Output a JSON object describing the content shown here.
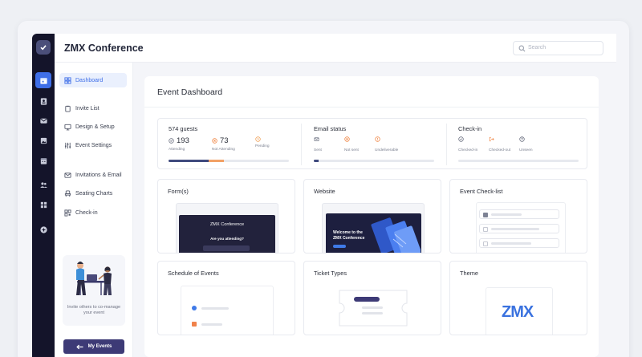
{
  "app": {
    "title": "ZMX Conference",
    "search_placeholder": "Search",
    "accent_color": "#3f6fe8",
    "rail_color": "#14142a"
  },
  "rail": {
    "icons": [
      "check-logo-icon",
      "calendar-icon",
      "contacts-icon",
      "mail-icon",
      "image-icon",
      "calendar-grid-icon",
      "users-icon",
      "apps-icon",
      "plus-circle-icon"
    ]
  },
  "sidebar": {
    "items": [
      {
        "label": "Dashboard",
        "icon": "dashboard-icon",
        "active": true
      },
      {
        "label": "Invite List",
        "icon": "clipboard-icon"
      },
      {
        "label": "Design & Setup",
        "icon": "monitor-icon"
      },
      {
        "label": "Event Settings",
        "icon": "sliders-icon"
      },
      {
        "label": "Invitations & Email",
        "icon": "mail-icon"
      },
      {
        "label": "Seating Charts",
        "icon": "seat-icon"
      },
      {
        "label": "Check-in",
        "icon": "qr-icon"
      }
    ],
    "promo_text": "Invite others to co-manage your event",
    "my_events_label": "My Events"
  },
  "dashboard": {
    "title": "Event Dashboard",
    "guests": {
      "heading": "574 guests",
      "attending": {
        "value": "193",
        "label": "Attending"
      },
      "not_attending": {
        "value": "73",
        "label": "Not Attending"
      },
      "pending": {
        "label": "Pending"
      },
      "progress": {
        "attending_fraction": 0.336,
        "not_attending_fraction": 0.127
      }
    },
    "email": {
      "heading": "Email status",
      "sent": "Sent",
      "not_sent": "Not sent",
      "undeliverable": "Undeliverable",
      "progress_fraction": 0.04
    },
    "checkin": {
      "heading": "Check-in",
      "checked_in": "Checked-in",
      "checked_out": "Checked-out",
      "unseen": "Unseen"
    },
    "cards": {
      "forms": {
        "title": "Form(s)",
        "thumb_title": "ZMX Conference",
        "thumb_question": "Are you attending?"
      },
      "website": {
        "title": "Website",
        "thumb_text_1": "Welcome to the",
        "thumb_text_2": "ZMX Conference"
      },
      "event_checklist": {
        "title": "Event Check-list"
      },
      "schedule": {
        "title": "Schedule of Events"
      },
      "ticket_types": {
        "title": "Ticket Types"
      },
      "theme": {
        "title": "Theme",
        "logo_text": "ZMX"
      }
    }
  }
}
